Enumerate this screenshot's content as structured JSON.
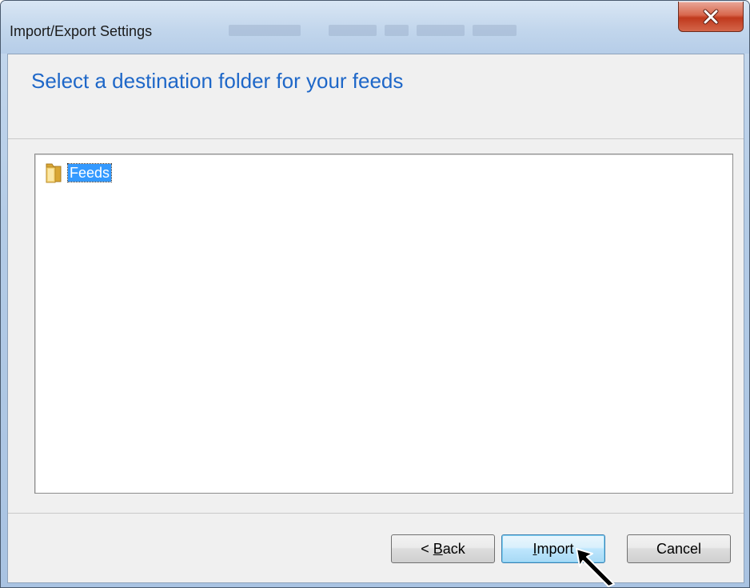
{
  "window": {
    "title": "Import/Export Settings",
    "close_icon": "close-x-icon"
  },
  "header": {
    "heading": "Select a destination folder for your feeds"
  },
  "tree": {
    "items": [
      {
        "label": "Feeds",
        "icon": "folder-icon",
        "selected": true
      }
    ]
  },
  "buttons": {
    "back_prefix": "< ",
    "back_mnemonic": "B",
    "back_rest": "ack",
    "import_mnemonic": "I",
    "import_rest": "mport",
    "cancel": "Cancel"
  },
  "colors": {
    "heading": "#1e67c8",
    "selection": "#3399ff",
    "close_button": "#c0391d"
  },
  "cursor": {
    "icon": "arrow-cursor-icon"
  }
}
